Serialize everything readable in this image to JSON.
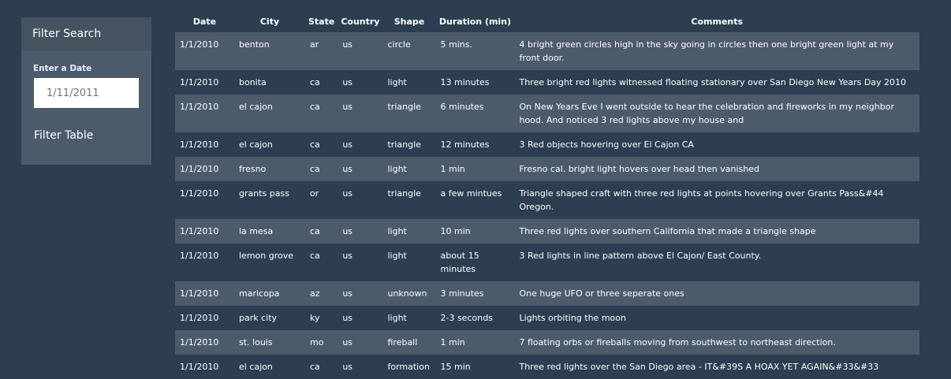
{
  "sidebar": {
    "title": "Filter Search",
    "date_label": "Enter a Date",
    "date_placeholder": "1/11/2011",
    "filter_button": "Filter Table"
  },
  "table": {
    "headers": [
      "Date",
      "City",
      "State",
      "Country",
      "Shape",
      "Duration (min)",
      "Comments"
    ],
    "rows": [
      [
        "1/1/2010",
        "benton",
        "ar",
        "us",
        "circle",
        "5 mins.",
        "4 bright green circles high in the sky going in circles then one bright green light at my front door."
      ],
      [
        "1/1/2010",
        "bonita",
        "ca",
        "us",
        "light",
        "13 minutes",
        "Three bright red lights witnessed floating stationary over San Diego New Years Day 2010"
      ],
      [
        "1/1/2010",
        "el cajon",
        "ca",
        "us",
        "triangle",
        "6 minutes",
        "On New Years Eve I went outside to hear the celebration and fireworks in my neighbor hood. And noticed 3 red lights above my house and"
      ],
      [
        "1/1/2010",
        "el cajon",
        "ca",
        "us",
        "triangle",
        "12 minutes",
        "3 Red objects hovering over El Cajon CA"
      ],
      [
        "1/1/2010",
        "fresno",
        "ca",
        "us",
        "light",
        "1 min",
        "Fresno cal. bright light hovers over head then vanished"
      ],
      [
        "1/1/2010",
        "grants pass",
        "or",
        "us",
        "triangle",
        "a few mintues",
        "Triangle shaped craft with three red lights at points hovering over Grants Pass&#44 Oregon."
      ],
      [
        "1/1/2010",
        "la mesa",
        "ca",
        "us",
        "light",
        "10 min",
        "Three red lights over southern California that made a triangle shape"
      ],
      [
        "1/1/2010",
        "lemon grove",
        "ca",
        "us",
        "light",
        "about 15 minutes",
        "3 Red lights in line pattern above El Cajon/ East County."
      ],
      [
        "1/1/2010",
        "maricopa",
        "az",
        "us",
        "unknown",
        "3 minutes",
        "One huge UFO or three seperate ones"
      ],
      [
        "1/1/2010",
        "park city",
        "ky",
        "us",
        "light",
        "2-3 seconds",
        "Lights orbiting the moon"
      ],
      [
        "1/1/2010",
        "st. louis",
        "mo",
        "us",
        "fireball",
        "1 min",
        "7 floating orbs or fireballs moving from southwest to northeast direction."
      ],
      [
        "1/1/2010",
        "el cajon",
        "ca",
        "us",
        "formation",
        "15 min",
        "Three red lights over the San Diego area - IT&#39S A HOAX YET AGAIN&#33&#33"
      ]
    ]
  }
}
